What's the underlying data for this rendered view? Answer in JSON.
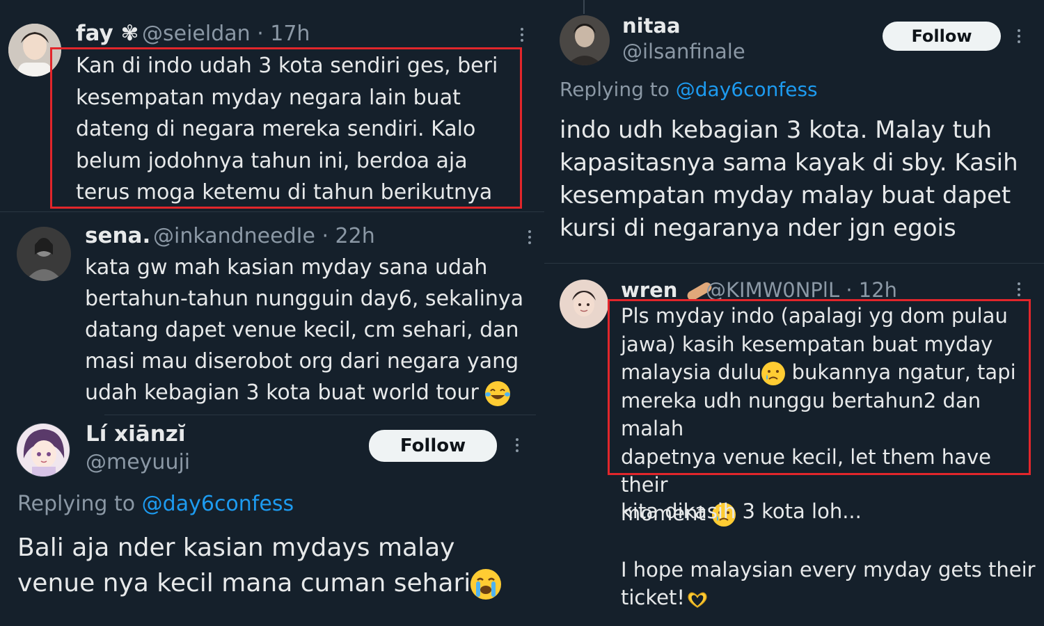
{
  "left": {
    "tweet1": {
      "name": "fay",
      "flower_icon": "flower-icon",
      "handle": "@seieldan · 17h",
      "lines": [
        "Kan di indo udah 3 kota sendiri ges, beri",
        "kesempatan myday negara lain buat",
        "dateng di negara mereka sendiri. Kalo",
        "belum jodohnya tahun ini, berdoa aja",
        "terus moga ketemu di tahun berikutnya"
      ]
    },
    "tweet2": {
      "name": "sena.",
      "handle": "@inkandneedIe · 22h",
      "lines": [
        "kata gw mah kasian myday sana udah",
        "bertahun-tahun nungguin day6, sekalinya",
        "datang dapet venue kecil, cm sehari, dan",
        "masi mau diserobot org dari negara yang",
        "udah kebagian 3 kota buat world tour"
      ],
      "emoji": "face-with-tears-of-joy"
    },
    "tweet3": {
      "name": "Lí xiānzĭ",
      "handle": "@meyuuji",
      "follow_label": "Follow",
      "replying_prefix": "Replying to ",
      "replying_mention": "@day6confess",
      "lines": [
        "Bali aja nder kasian mydays malay",
        "venue nya kecil mana cuman sehari"
      ],
      "emoji": "loudly-crying-face"
    }
  },
  "right": {
    "tweet1": {
      "name": "nitaa",
      "handle": "@ilsanfinale",
      "follow_label": "Follow",
      "replying_prefix": "Replying to ",
      "replying_mention": "@day6confess",
      "lines": [
        "indo udh kebagian 3 kota. Malay tuh",
        "kapasitasnya sama kayak di sby. Kasih",
        "kesempatan myday malay buat dapet",
        "kursi di negaranya nder jgn egois"
      ]
    },
    "tweet2": {
      "name": "wren",
      "bandage_icon": "adhesive-bandage-icon",
      "handle": "@KIMW0NPlL · 12h",
      "lines": [
        "Pls myday indo (apalagi yg dom pulau",
        "jawa) kasih kesempatan buat myday",
        "malaysia dulu",
        "bukannya ngatur, tapi",
        "mereka udh nunggu bertahun2 dan malah",
        "dapetnya venue kecil, let them have their",
        "moment"
      ],
      "emoji": "crying-face",
      "extra1": "kita dikasih 3 kota loh...",
      "extra2_line1": "I hope malaysian every myday gets their",
      "extra2_line2": "ticket!",
      "extra2_emoji": "heart-hands"
    }
  }
}
